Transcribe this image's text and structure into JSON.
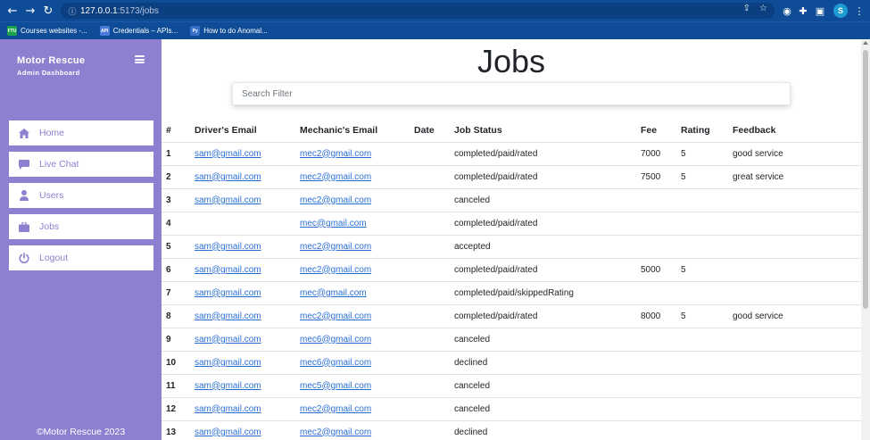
{
  "browser": {
    "url_host": "127.0.0.1",
    "url_path": ":5173/jobs",
    "profile_initial": "S",
    "bookmarks": [
      {
        "label": "Courses websites -...",
        "icon": "FTU",
        "color": "#1aa34a"
      },
      {
        "label": "Credentials – APIs...",
        "icon": "API",
        "color": "#4a7bd8"
      },
      {
        "label": "How to do Anomal...",
        "icon": "Py",
        "color": "#3670c8"
      }
    ]
  },
  "sidebar": {
    "title": "Motor Rescue",
    "subtitle": "Admin Dashboard",
    "items": [
      {
        "label": "Home",
        "icon": "home-icon"
      },
      {
        "label": "Live Chat",
        "icon": "chat-icon"
      },
      {
        "label": "Users",
        "icon": "user-icon"
      },
      {
        "label": "Jobs",
        "icon": "briefcase-icon"
      },
      {
        "label": "Logout",
        "icon": "power-icon"
      }
    ],
    "copyright": "©Motor Rescue 2023"
  },
  "main": {
    "title": "Jobs",
    "search_placeholder": "Search Filter"
  },
  "table": {
    "headers": [
      "#",
      "Driver's Email",
      "Mechanic's Email",
      "Date",
      "Job Status",
      "Fee",
      "Rating",
      "Feedback"
    ],
    "rows": [
      {
        "num": "1",
        "driver": "sam@gmail.com",
        "mechanic": "mec2@gmail.com",
        "date": "",
        "status": "completed/paid/rated",
        "fee": "7000",
        "rating": "5",
        "feedback": "good service"
      },
      {
        "num": "2",
        "driver": "sam@gmail.com",
        "mechanic": "mec2@gmail.com",
        "date": "",
        "status": "completed/paid/rated",
        "fee": "7500",
        "rating": "5",
        "feedback": "great service"
      },
      {
        "num": "3",
        "driver": "sam@gmail.com",
        "mechanic": "mec2@gmail.com",
        "date": "",
        "status": "canceled",
        "fee": "",
        "rating": "",
        "feedback": ""
      },
      {
        "num": "4",
        "driver": "",
        "mechanic": "mec@gmail.com",
        "date": "",
        "status": "completed/paid/rated",
        "fee": "",
        "rating": "",
        "feedback": ""
      },
      {
        "num": "5",
        "driver": "sam@gmail.com",
        "mechanic": "mec2@gmail.com",
        "date": "",
        "status": "accepted",
        "fee": "",
        "rating": "",
        "feedback": ""
      },
      {
        "num": "6",
        "driver": "sam@gmail.com",
        "mechanic": "mec2@gmail.com",
        "date": "",
        "status": "completed/paid/rated",
        "fee": "5000",
        "rating": "5",
        "feedback": ""
      },
      {
        "num": "7",
        "driver": "sam@gmail.com",
        "mechanic": "mec@gmail.com",
        "date": "",
        "status": "completed/paid/skippedRating",
        "fee": "",
        "rating": "",
        "feedback": ""
      },
      {
        "num": "8",
        "driver": "sam@gmail.com",
        "mechanic": "mec2@gmail.com",
        "date": "",
        "status": "completed/paid/rated",
        "fee": "8000",
        "rating": "5",
        "feedback": "good service"
      },
      {
        "num": "9",
        "driver": "sam@gmail.com",
        "mechanic": "mec6@gmail.com",
        "date": "",
        "status": "canceled",
        "fee": "",
        "rating": "",
        "feedback": ""
      },
      {
        "num": "10",
        "driver": "sam@gmail.com",
        "mechanic": "mec6@gmail.com",
        "date": "",
        "status": "declined",
        "fee": "",
        "rating": "",
        "feedback": ""
      },
      {
        "num": "11",
        "driver": "sam@gmail.com",
        "mechanic": "mec5@gmail.com",
        "date": "",
        "status": "canceled",
        "fee": "",
        "rating": "",
        "feedback": ""
      },
      {
        "num": "12",
        "driver": "sam@gmail.com",
        "mechanic": "mec2@gmail.com",
        "date": "",
        "status": "canceled",
        "fee": "",
        "rating": "",
        "feedback": ""
      },
      {
        "num": "13",
        "driver": "sam@gmail.com",
        "mechanic": "mec2@gmail.com",
        "date": "",
        "status": "declined",
        "fee": "",
        "rating": "",
        "feedback": ""
      }
    ]
  },
  "colors": {
    "sidebar": "#8f7fd0",
    "link": "#2a6fd6",
    "browser_chrome": "#0f4c97"
  }
}
